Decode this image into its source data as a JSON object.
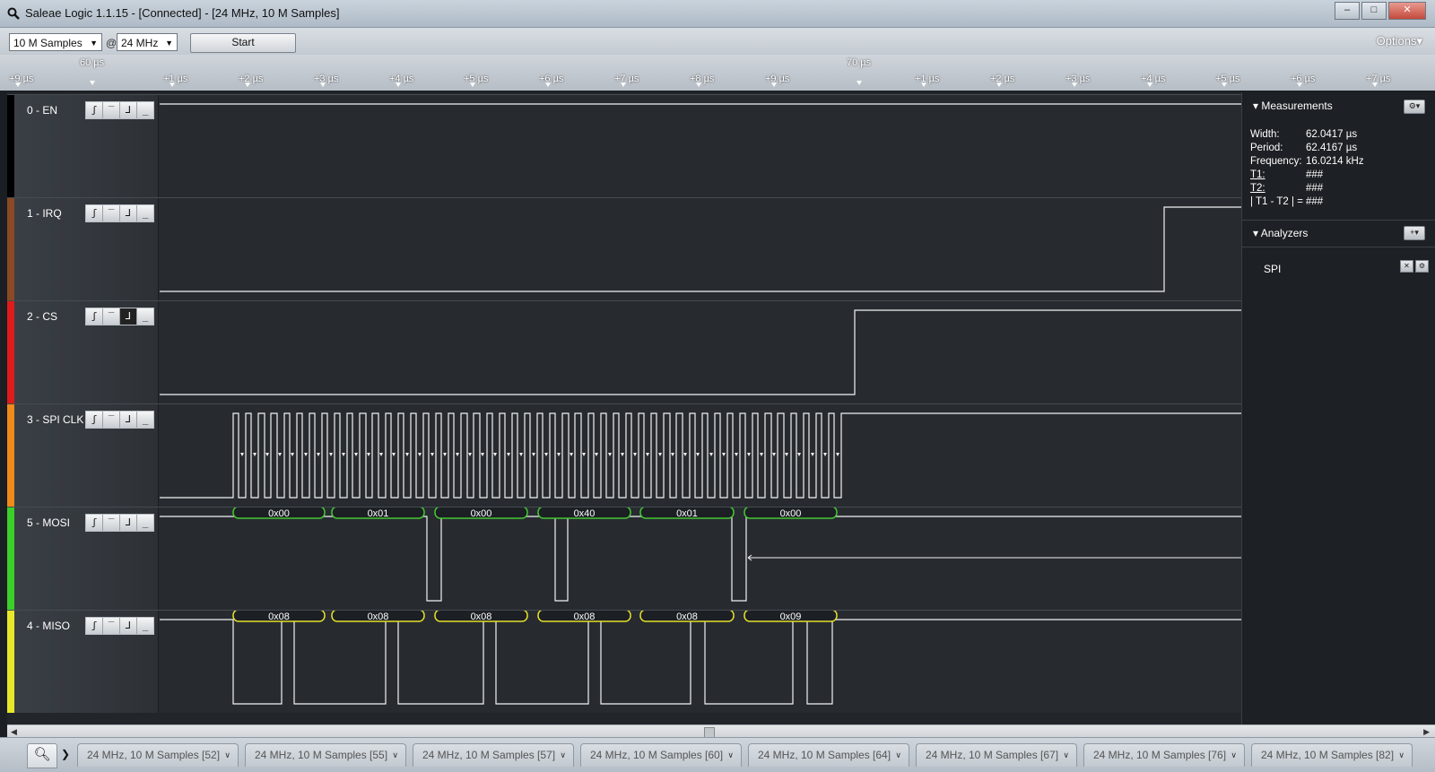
{
  "window": {
    "title": "Saleae Logic 1.1.15 - [Connected] - [24 MHz, 10 M Samples]",
    "buttons": {
      "minimize": "–",
      "maximize": "□",
      "close": "✕"
    }
  },
  "toolbar": {
    "samples": "10 M Samples",
    "at": "@",
    "rate": "24 MHz",
    "start_label": "Start",
    "options_label": "Options▾"
  },
  "timeline": {
    "left_marker": "60 µs",
    "right_marker": "70 µs",
    "ticks": [
      "+9 µs",
      "+1 µs",
      "+2 µs",
      "+3 µs",
      "+4 µs",
      "+5 µs",
      "+6 µs",
      "+7 µs",
      "+8 µs",
      "+9 µs",
      "+1 µs",
      "+2 µs",
      "+3 µs",
      "+4 µs",
      "+5 µs",
      "+6 µs",
      "+7 µs"
    ]
  },
  "channels": [
    {
      "name": "0 - EN",
      "color": "#000000",
      "trigger": [
        "ʃ",
        "‾",
        "⅃",
        "_"
      ],
      "active": -1
    },
    {
      "name": "1 - IRQ",
      "color": "#8b4a25",
      "trigger": [
        "ʃ",
        "‾",
        "⅃",
        "_"
      ],
      "active": -1
    },
    {
      "name": "2 - CS",
      "color": "#e01b1b",
      "trigger": [
        "ʃ",
        "‾",
        "⅃",
        "_"
      ],
      "active": 2
    },
    {
      "name": "3 - SPI CLK",
      "color": "#f08a1a",
      "trigger": [
        "ʃ",
        "‾",
        "⅃",
        "_"
      ],
      "active": -1
    },
    {
      "name": "5 - MOSI",
      "color": "#3ccf2c",
      "trigger": [
        "ʃ",
        "‾",
        "⅃",
        "_"
      ],
      "active": -1
    },
    {
      "name": "4 - MISO",
      "color": "#e8e82a",
      "trigger": [
        "ʃ",
        "‾",
        "⅃",
        "_"
      ],
      "active": -1
    }
  ],
  "decoded": {
    "mosi": [
      "0x00",
      "0x01",
      "0x00",
      "0x40",
      "0x01",
      "0x00"
    ],
    "miso": [
      "0x08",
      "0x08",
      "0x08",
      "0x08",
      "0x08",
      "0x09"
    ],
    "mosi_color": "#44c832",
    "miso_color": "#e6e02a"
  },
  "measurements": {
    "header": "Measurements",
    "rows": [
      {
        "k": "Width:",
        "v": "62.0417 µs"
      },
      {
        "k": "Period:",
        "v": "62.4167 µs"
      },
      {
        "k": "Frequency:",
        "v": "16.0214 kHz"
      },
      {
        "k": "T1:",
        "v": "###"
      },
      {
        "k": "T2:",
        "v": "###"
      },
      {
        "k": "| T1 - T2 | =",
        "v": "###"
      }
    ]
  },
  "analyzers": {
    "header": "Analyzers",
    "items": [
      "SPI"
    ]
  },
  "capture_tabs": [
    "24 MHz, 10 M Samples [52]",
    "24 MHz, 10 M Samples [55]",
    "24 MHz, 10 M Samples [57]",
    "24 MHz, 10 M Samples [60]",
    "24 MHz, 10 M Samples [64]",
    "24 MHz, 10 M Samples [67]",
    "24 MHz, 10 M Samples [76]",
    "24 MHz, 10 M Samples [82]"
  ]
}
